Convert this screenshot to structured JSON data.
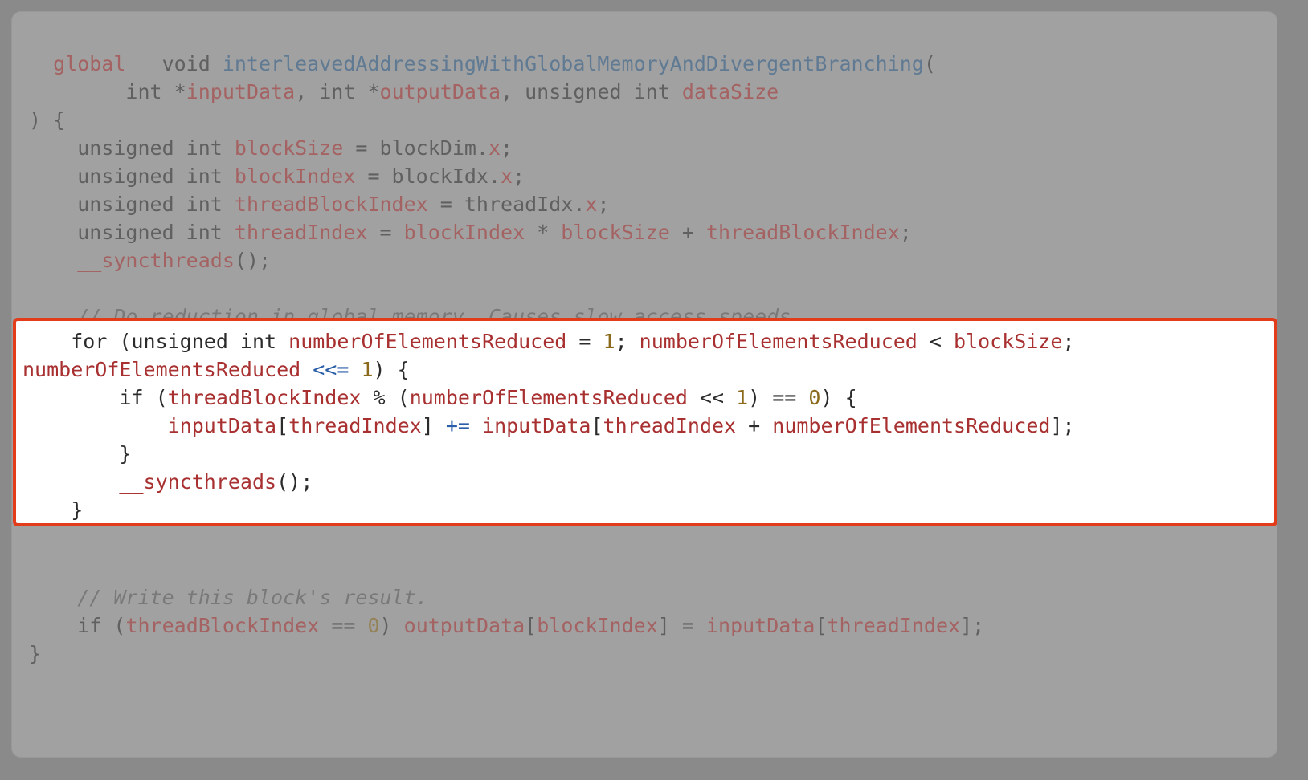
{
  "code": {
    "l1_a": "__global__",
    "l1_b": " void ",
    "l1_c": "interleavedAddressingWithGlobalMemoryAndDivergentBranching",
    "l1_d": "(",
    "l2_a": "        int *",
    "l2_b": "inputData",
    "l2_c": ", int *",
    "l2_d": "outputData",
    "l2_e": ", unsigned int ",
    "l2_f": "dataSize",
    "l3": ") {",
    "l4_a": "    unsigned int ",
    "l4_b": "blockSize",
    "l4_c": " = blockDim.",
    "l4_d": "x",
    "l4_e": ";",
    "l5_a": "    unsigned int ",
    "l5_b": "blockIndex",
    "l5_c": " = blockIdx.",
    "l5_d": "x",
    "l5_e": ";",
    "l6_a": "    unsigned int ",
    "l6_b": "threadBlockIndex",
    "l6_c": " = threadIdx.",
    "l6_d": "x",
    "l6_e": ";",
    "l7_a": "    unsigned int ",
    "l7_b": "threadIndex",
    "l7_c": " = ",
    "l7_d": "blockIndex",
    "l7_e": " * ",
    "l7_f": "blockSize",
    "l7_g": " + ",
    "l7_h": "threadBlockIndex",
    "l7_i": ";",
    "l8_a": "    ",
    "l8_b": "__syncthreads",
    "l8_c": "();",
    "l9": "",
    "l10_a": "    ",
    "l10_b": "// Do reduction in global memory. Causes slow access speeds.",
    "h1_a": "    for (unsigned int ",
    "h1_b": "numberOfElementsReduced",
    "h1_c": " = ",
    "h1_d": "1",
    "h1_e": "; ",
    "h1_f": "numberOfElementsReduced",
    "h1_g": " < ",
    "h1_h": "blockSize",
    "h1_i": "; ",
    "h2_a": "numberOfElementsReduced",
    "h2_b": " <<= ",
    "h2_c": "1",
    "h2_d": ") {",
    "h3_a": "        if (",
    "h3_b": "threadBlockIndex",
    "h3_c": " % (",
    "h3_d": "numberOfElementsReduced",
    "h3_e": " << ",
    "h3_f": "1",
    "h3_g": ") == ",
    "h3_h": "0",
    "h3_i": ") {",
    "h4_a": "            ",
    "h4_b": "inputData",
    "h4_c": "[",
    "h4_d": "threadIndex",
    "h4_e": "] ",
    "h4_f": "+=",
    "h4_g": " ",
    "h4_h": "inputData",
    "h4_i": "[",
    "h4_j": "threadIndex",
    "h4_k": " + ",
    "h4_l": "numberOfElementsReduced",
    "h4_m": "];",
    "h5": "        }",
    "h6_a": "        ",
    "h6_b": "__syncthreads",
    "h6_c": "();",
    "h7": "    }",
    "l11": "",
    "l12_a": "    ",
    "l12_b": "// Write this block's result.",
    "l13_a": "    if (",
    "l13_b": "threadBlockIndex",
    "l13_c": " == ",
    "l13_d": "0",
    "l13_e": ") ",
    "l13_f": "outputData",
    "l13_g": "[",
    "l13_h": "blockIndex",
    "l13_i": "] = ",
    "l13_j": "inputData",
    "l13_k": "[",
    "l13_l": "threadIndex",
    "l13_m": "];",
    "l14": "}"
  }
}
